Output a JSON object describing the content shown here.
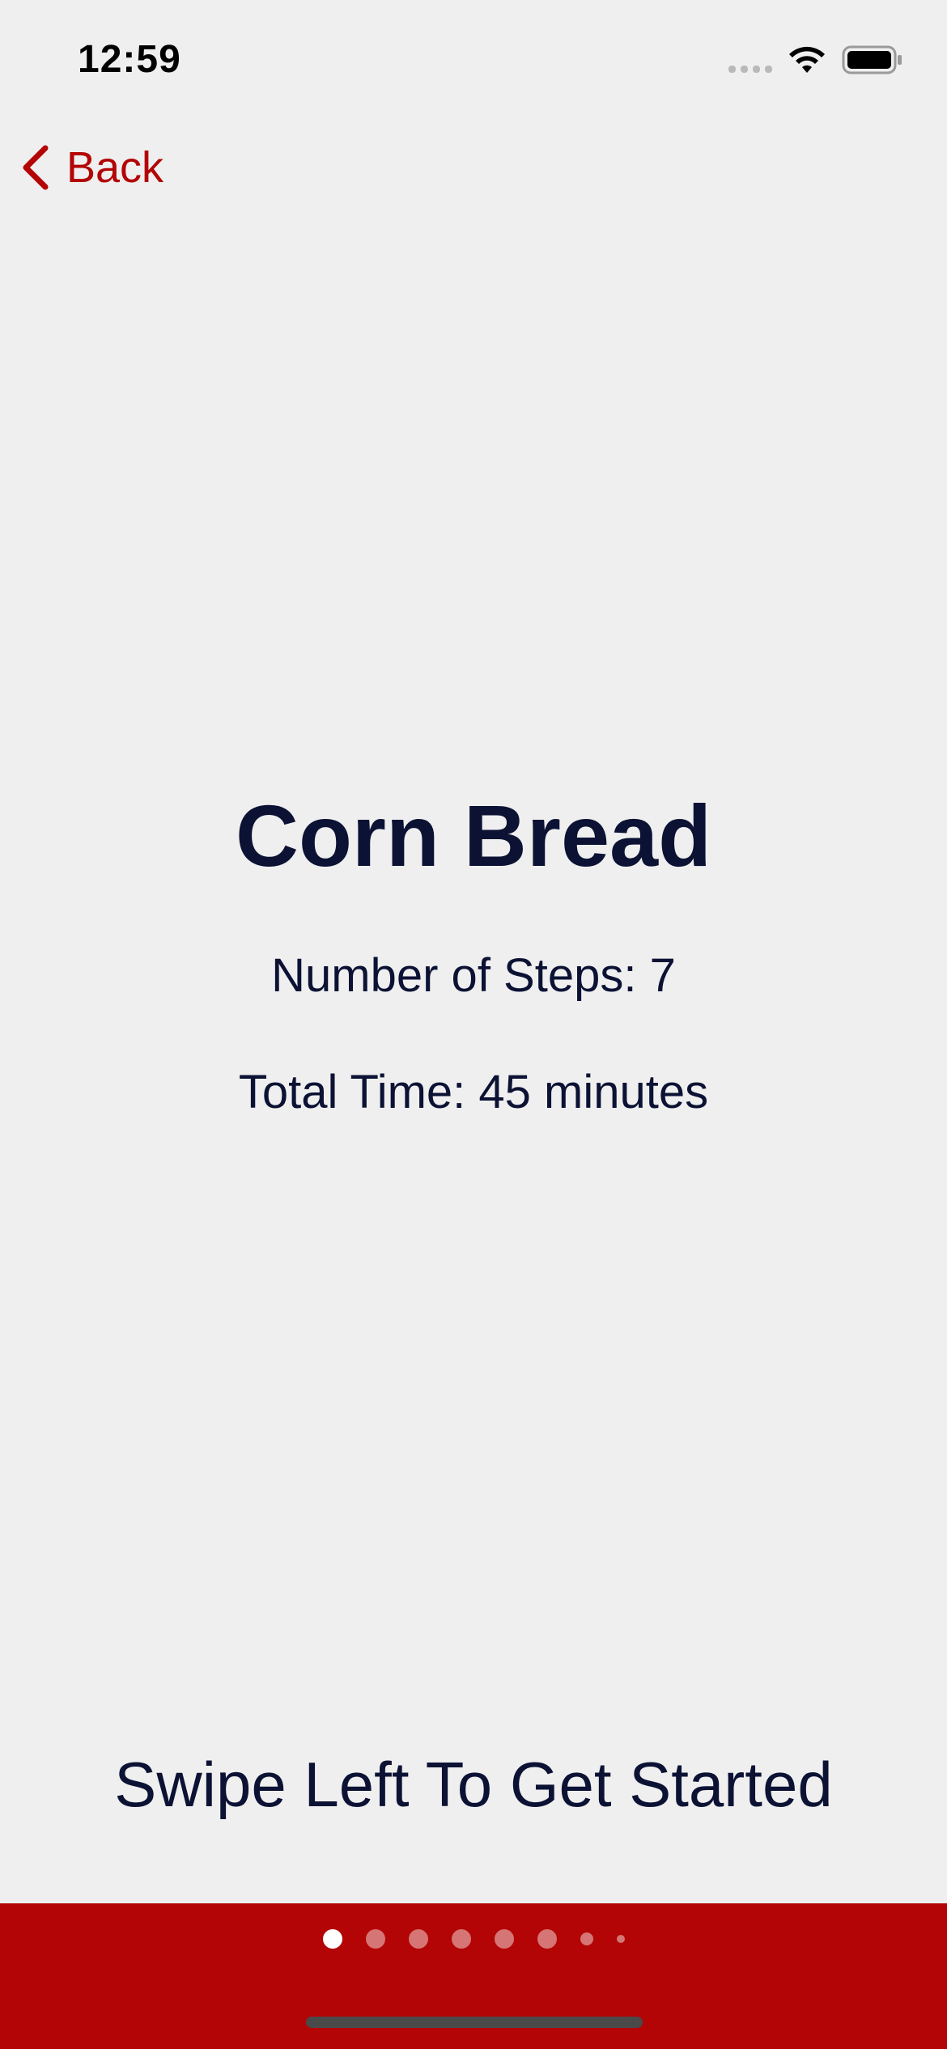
{
  "status_bar": {
    "time": "12:59",
    "icons": [
      "signal-icon",
      "wifi-icon",
      "battery-icon"
    ]
  },
  "nav": {
    "back_label": "Back",
    "accent_color": "#b30505"
  },
  "recipe": {
    "title": "Corn Bread",
    "steps_text": "Number of Steps: 7",
    "time_text": "Total Time: 45 minutes"
  },
  "hint": {
    "swipe_text": "Swipe Left To Get Started"
  },
  "pager": {
    "total_dots": 8,
    "active_index": 0,
    "bar_color": "#b30505"
  },
  "colors": {
    "background": "#efefef",
    "text": "#0c1234"
  }
}
